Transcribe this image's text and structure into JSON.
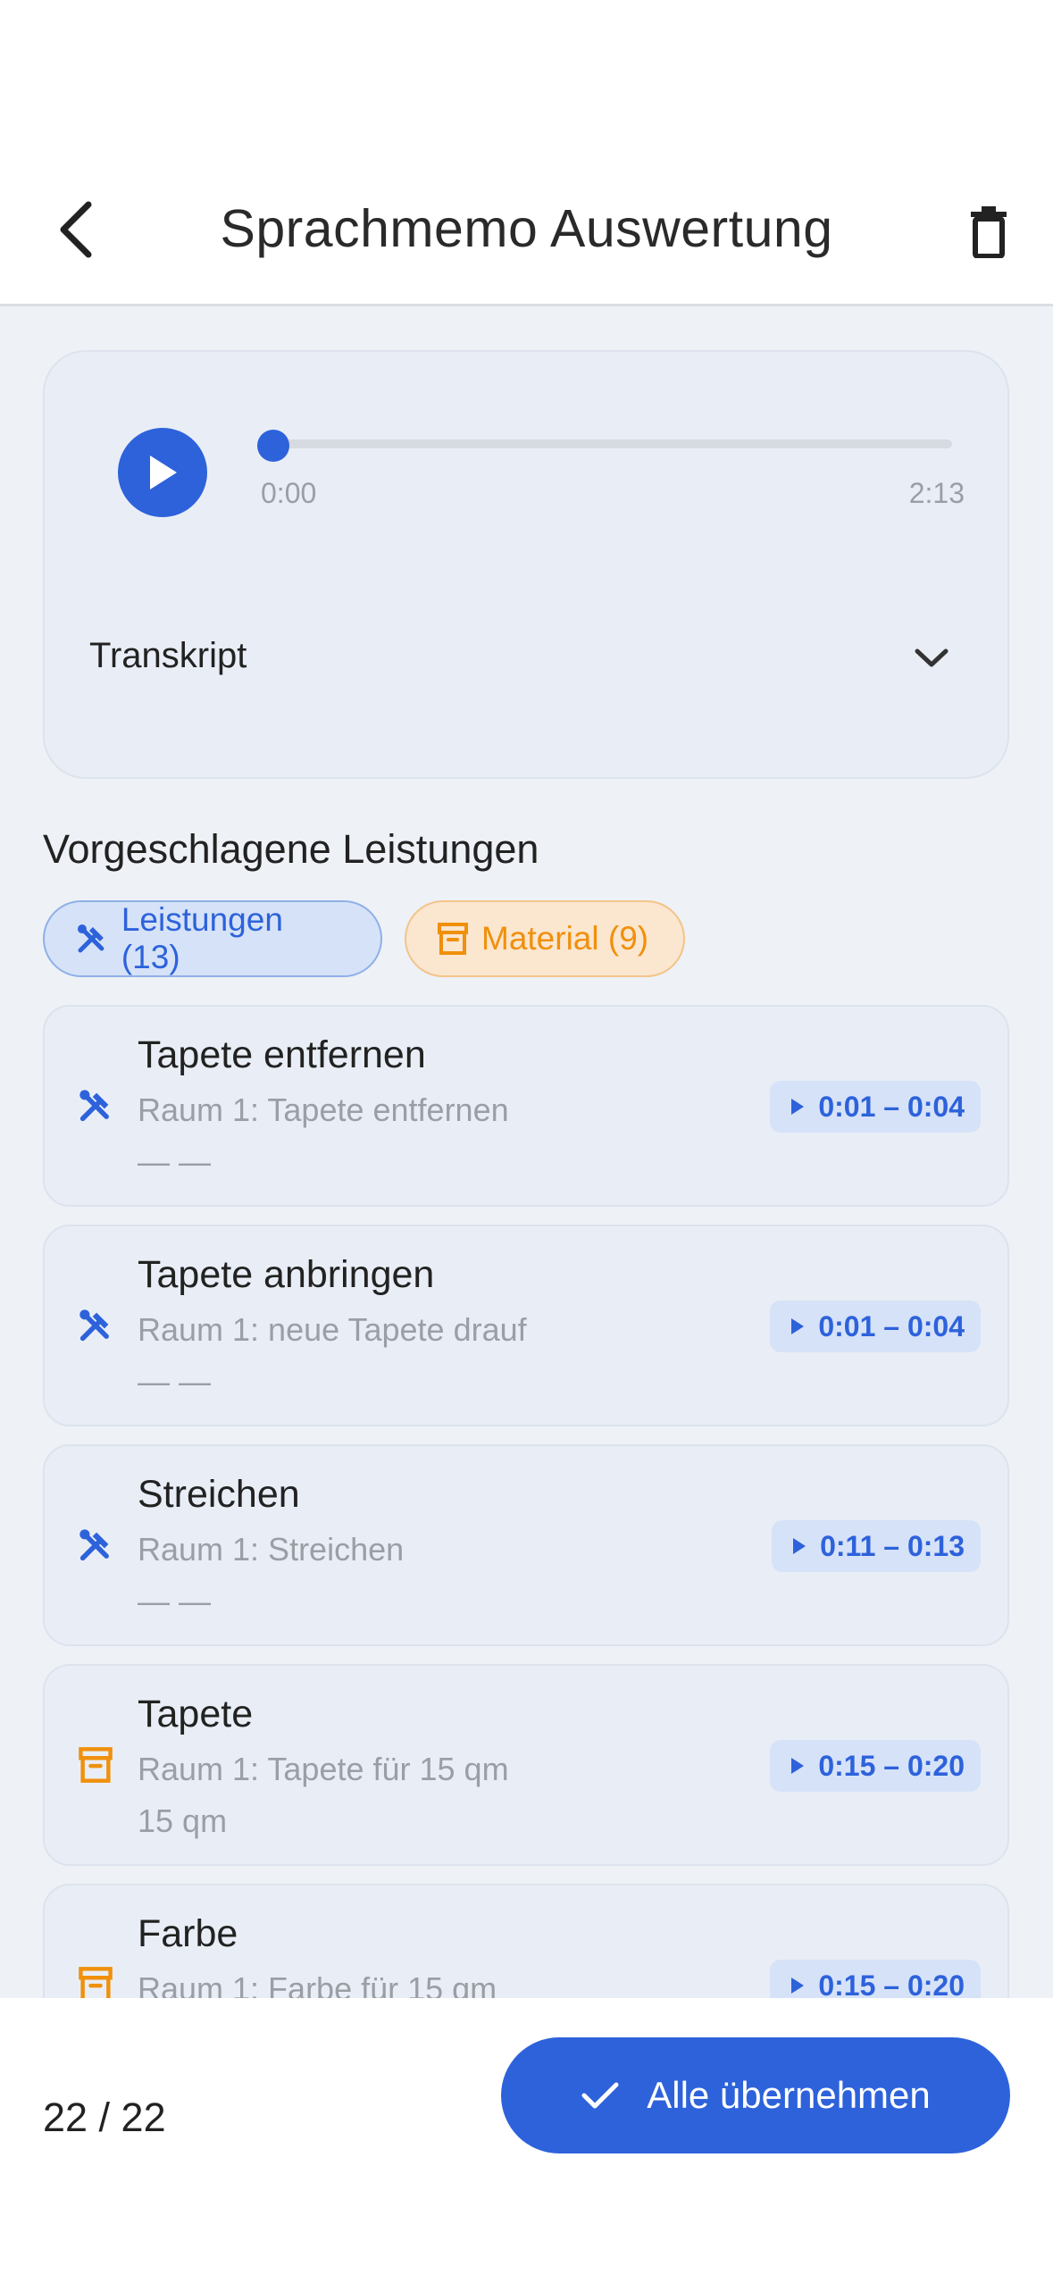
{
  "header": {
    "title": "Sprachmemo Auswertung",
    "back_icon": "chevron-left-icon",
    "delete_icon": "trash-icon"
  },
  "player": {
    "current_time": "0:00",
    "duration": "2:13",
    "progress": 0,
    "transcript_label": "Transkript"
  },
  "suggestions": {
    "section_title": "Vorgeschlagene Leistungen",
    "filters": [
      {
        "label": "Leistungen (13)",
        "icon": "tools-icon",
        "color": "#2d62db"
      },
      {
        "label": "Material (9)",
        "icon": "archive-box-icon",
        "color": "#f0900c"
      }
    ],
    "items": [
      {
        "type": "service",
        "icon": "tools-icon",
        "title": "Tapete entfernen",
        "subtitle": "Raum 1: Tapete entfernen",
        "extra": "— —",
        "timestamp": "0:01 – 0:04"
      },
      {
        "type": "service",
        "icon": "tools-icon",
        "title": "Tapete anbringen",
        "subtitle": "Raum 1: neue Tapete drauf",
        "extra": "— —",
        "timestamp": "0:01 – 0:04"
      },
      {
        "type": "service",
        "icon": "tools-icon",
        "title": "Streichen",
        "subtitle": "Raum 1: Streichen",
        "extra": "— —",
        "timestamp": "0:11 – 0:13"
      },
      {
        "type": "material",
        "icon": "archive-box-icon",
        "title": "Tapete",
        "subtitle": "Raum 1: Tapete für 15 qm",
        "extra": "15 qm",
        "timestamp": "0:15 – 0:20"
      },
      {
        "type": "material",
        "icon": "archive-box-icon",
        "title": "Farbe",
        "subtitle": "Raum 1: Farbe für 15 qm",
        "extra": "",
        "timestamp": "0:15 – 0:20"
      }
    ]
  },
  "footer": {
    "counter": "22 / 22",
    "accept_label": "Alle übernehmen",
    "accept_icon": "check-icon"
  },
  "colors": {
    "accent": "#2d62db",
    "material": "#f0900c",
    "background": "#eef1f6"
  }
}
